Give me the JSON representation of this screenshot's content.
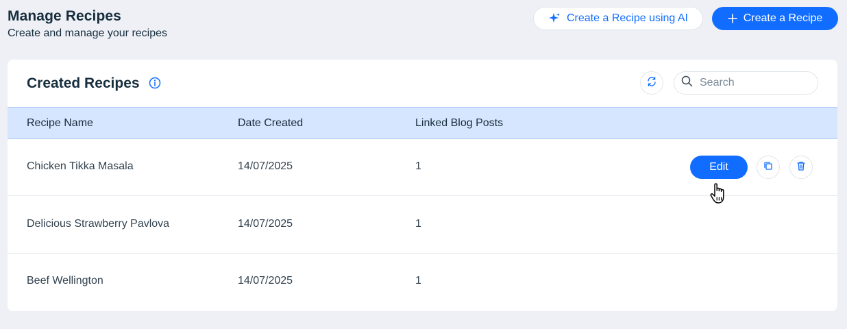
{
  "header": {
    "title": "Manage Recipes",
    "subtitle": "Create and manage your recipes",
    "ai_button_label": "Create a Recipe using AI",
    "create_button_label": "Create a Recipe"
  },
  "card": {
    "title": "Created Recipes",
    "search_placeholder": "Search"
  },
  "table": {
    "columns": [
      "Recipe Name",
      "Date Created",
      "Linked Blog Posts"
    ],
    "rows": [
      {
        "name": "Chicken Tikka Masala",
        "date": "14/07/2025",
        "linked": "1"
      },
      {
        "name": "Delicious Strawberry Pavlova",
        "date": "14/07/2025",
        "linked": "1"
      },
      {
        "name": "Beef Wellington",
        "date": "14/07/2025",
        "linked": "1"
      }
    ],
    "edit_label": "Edit"
  },
  "icons": {
    "ai": "sparkle-icon",
    "create": "plus-icon",
    "info": "info-icon",
    "refresh": "refresh-icon",
    "search": "search-icon",
    "duplicate": "duplicate-icon",
    "delete": "trash-icon",
    "cursor": "hand-pointer-icon"
  },
  "colors": {
    "accent": "#116dff",
    "page_bg": "#eef0f5",
    "table_header_bg": "#d6e6fe"
  }
}
